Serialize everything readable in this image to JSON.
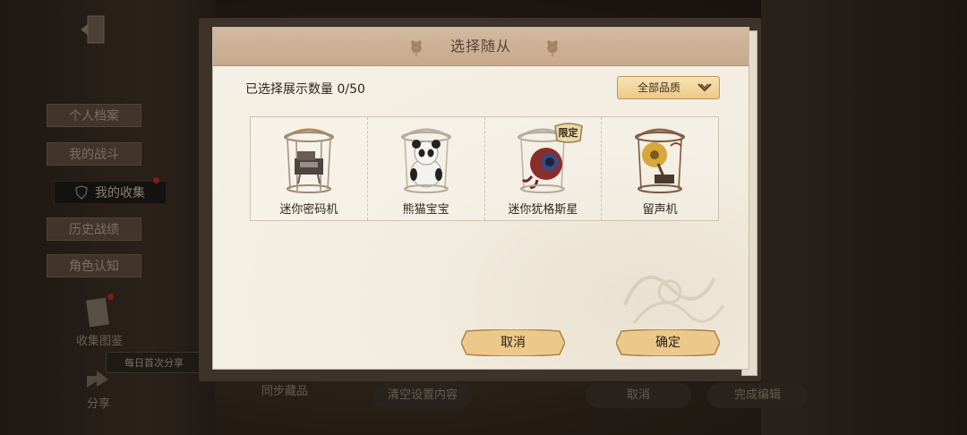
{
  "background": {
    "tabs": [
      {
        "label": "个人档案"
      },
      {
        "label": "我的战斗"
      },
      {
        "label": "我的收集"
      },
      {
        "label": "历史战绩"
      },
      {
        "label": "角色认知"
      }
    ],
    "collection_label": "收集图鉴",
    "share_tip": "每日首次分享",
    "share_label": "分享",
    "bottom_left_text": "同步藏品",
    "clear_button": "清空设置内容",
    "cancel_button": "取消",
    "finish_button": "完成编辑"
  },
  "dialog": {
    "title": "选择随从",
    "count_text": "已选择展示数量 0/50",
    "quality_filter": "全部品质",
    "items": [
      {
        "name": "迷你密码机",
        "icon": "cipher-machine-icon",
        "badge": ""
      },
      {
        "name": "熊猫宝宝",
        "icon": "panda-icon",
        "badge": ""
      },
      {
        "name": "迷你犹格斯星",
        "icon": "yuggoth-planet-icon",
        "badge": "限定"
      },
      {
        "name": "留声机",
        "icon": "gramophone-icon",
        "badge": ""
      }
    ],
    "cancel_label": "取消",
    "confirm_label": "确定"
  },
  "colors": {
    "paper": "#f3ede0",
    "header": "#c6a88c",
    "button_gold": "#ecc985"
  }
}
